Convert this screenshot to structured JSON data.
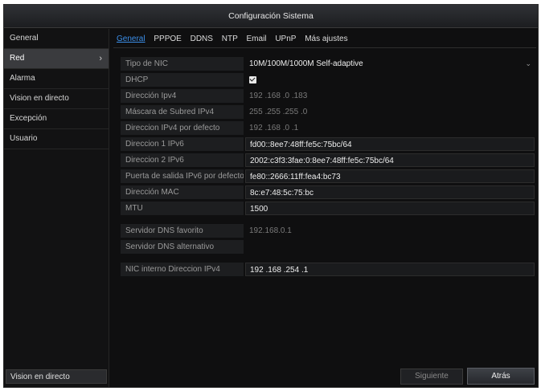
{
  "window": {
    "title": "Configuración Sistema"
  },
  "sidebar": {
    "items": [
      {
        "label": "General"
      },
      {
        "label": "Red",
        "chevron": "›"
      },
      {
        "label": "Alarma"
      },
      {
        "label": "Vision en directo"
      },
      {
        "label": "Excepción"
      },
      {
        "label": "Usuario"
      }
    ],
    "bottom_label": "Vision en directo"
  },
  "tabs": [
    "General",
    "PPPOE",
    "DDNS",
    "NTP",
    "Email",
    "UPnP",
    "Más ajustes"
  ],
  "form": {
    "tipo_nic": {
      "label": "Tipo de NIC",
      "value": "10M/100M/1000M Self-adaptive",
      "arrow": "⌄"
    },
    "dhcp": {
      "label": "DHCP"
    },
    "ipv4": {
      "label": "Dirección Ipv4",
      "value": "192 .168 .0    .183"
    },
    "subnet": {
      "label": "Máscara de Subred IPv4",
      "value": "255 .255 .255 .0"
    },
    "gateway": {
      "label": "Direccion IPv4 por defecto",
      "value": "192 .168 .0    .1"
    },
    "ipv6_1": {
      "label": "Direccion 1 IPv6",
      "value": "fd00::8ee7:48ff:fe5c:75bc/64"
    },
    "ipv6_2": {
      "label": "Direccion 2 IPv6",
      "value": "2002:c3f3:3fae:0:8ee7:48ff:fe5c:75bc/64"
    },
    "ipv6_gw": {
      "label": "Puerta de salida IPv6 por defecto",
      "value": "fe80::2666:11ff:fea4:bc73"
    },
    "mac": {
      "label": "Dirección MAC",
      "value": "8c:e7:48:5c:75:bc"
    },
    "mtu": {
      "label": "MTU",
      "value": "1500"
    },
    "dns1": {
      "label": "Servidor DNS favorito",
      "value": "192.168.0.1"
    },
    "dns2": {
      "label": "Servidor DNS alternativo",
      "value": ""
    },
    "nic_int": {
      "label": "NIC interno Direccion IPv4",
      "value": "192 .168 .254 .1"
    }
  },
  "buttons": {
    "next": "Siguiente",
    "back": "Atrás"
  }
}
